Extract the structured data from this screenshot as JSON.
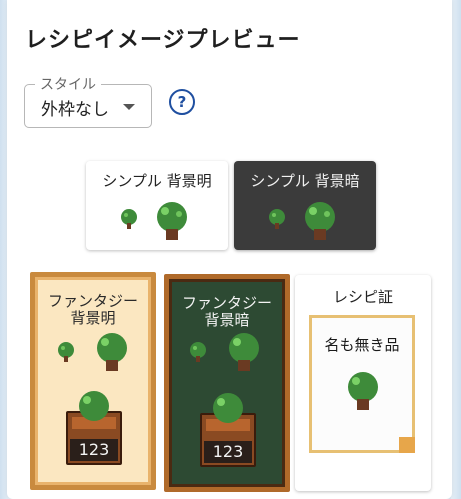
{
  "title": "レシピイメージプレビュー",
  "style_select": {
    "label": "スタイル",
    "value": "外枠なし"
  },
  "cards": {
    "simple_light": "シンプル 背景明",
    "simple_dark": "シンプル 背景暗",
    "fantasy_light": [
      "ファンタジー",
      "背景明"
    ],
    "fantasy_dark": [
      "ファンタジー",
      "背景暗"
    ],
    "recipe": "レシピ証",
    "recipe_name": "名も無き品",
    "count": "123"
  },
  "colors": {
    "accent_blue": "#1f4fa0",
    "dark_card": "#3b3b3b",
    "fantasy_light_bg": "#fbe7c1",
    "fantasy_dark_bg": "#2d4a33",
    "tree_leaves": "#3e8b3a",
    "tree_trunk": "#6a3a22"
  }
}
